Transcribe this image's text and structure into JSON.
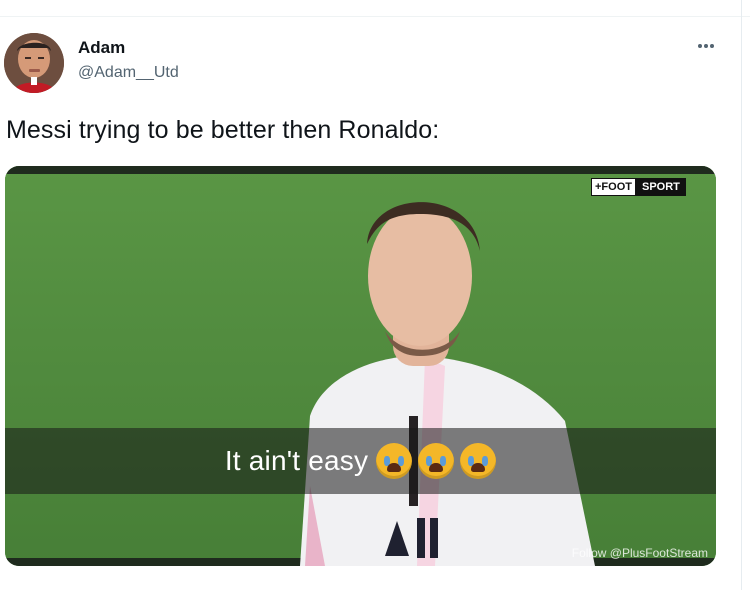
{
  "user": {
    "name": "Adam",
    "handle": "@Adam__Utd"
  },
  "tweet": {
    "text": "Messi trying to be better then Ronaldo:"
  },
  "media": {
    "logo_left": "+FOOT",
    "logo_right": "SPORT",
    "caption": "It ain't easy",
    "emojis": [
      "loudly-crying-face",
      "loudly-crying-face",
      "loudly-crying-face"
    ],
    "watermark": "Follow @PlusFootStream",
    "colors": {
      "pitch": "#4f8a3e",
      "caption_bar": "#181818",
      "emoji": "#f4b728"
    }
  },
  "icons": {
    "more": "ellipsis-icon"
  }
}
